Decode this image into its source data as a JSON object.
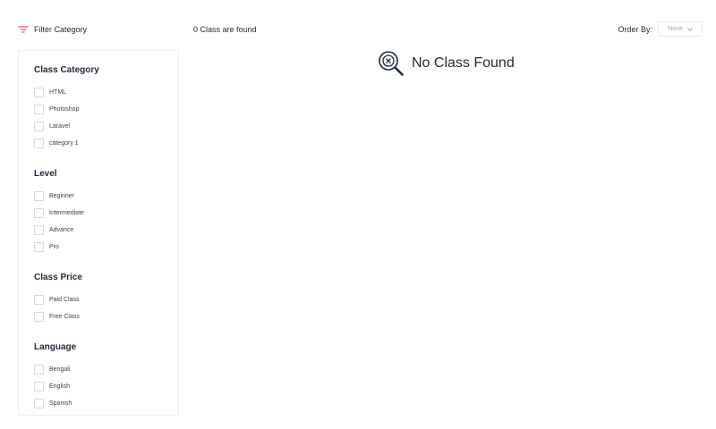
{
  "toolbar": {
    "filter_label": "Filter Category",
    "result_count": "0 Class are found",
    "order_label": "Order By:",
    "order_value": "None"
  },
  "filters": [
    {
      "title": "Class Category",
      "options": [
        "HTML",
        "Photoshop",
        "Laravel",
        "category 1"
      ]
    },
    {
      "title": "Level",
      "options": [
        "Beginner",
        "Intermediate",
        "Advance",
        "Pro"
      ]
    },
    {
      "title": "Class Price",
      "options": [
        "Paid Class",
        "Free Class"
      ]
    },
    {
      "title": "Language",
      "options": [
        "Bengali",
        "English",
        "Spanish"
      ]
    }
  ],
  "empty_state": {
    "message": "No Class Found"
  },
  "colors": {
    "accent": "#e0457b",
    "text": "#1e2a3a",
    "border": "#edf0f3"
  },
  "icons": {
    "filter": "filter-lines-icon",
    "dropdown": "chevron-down-icon",
    "empty": "search-x-icon"
  }
}
